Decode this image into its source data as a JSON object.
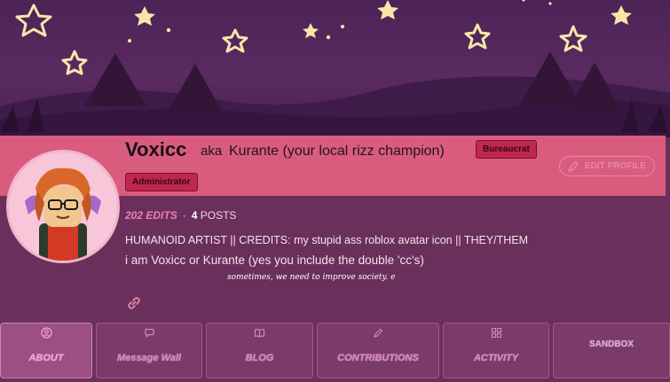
{
  "profile": {
    "username": "Voxicc",
    "aka_prefix": "aka",
    "aka_name": "Kurante (your local rizz champion)",
    "badges": [
      "Bureaucrat",
      "Administrator"
    ],
    "edit_profile_label": "EDIT PROFILE",
    "edits": "202 EDITS",
    "separator": "·",
    "posts_count": "4",
    "posts_label": "POSTS",
    "bio_line1": "HUMANOID ARTIST || CREDITS: my stupid ass roblox avatar icon || THEY/THEM",
    "bio_line2": "i am Voxicc or Kurante (yes you include the double 'cc's)",
    "bio_line3": "sometimes, we need to improve society. e"
  },
  "tabs": [
    {
      "label": "ABOUT",
      "icon": "user-icon"
    },
    {
      "label": "Message Wall",
      "icon": "speech-bubble-icon"
    },
    {
      "label": "BLOG",
      "icon": "book-icon"
    },
    {
      "label": "CONTRIBUTIONS",
      "icon": "pencil-icon"
    },
    {
      "label": "ACTIVITY",
      "icon": "grid-icon"
    },
    {
      "label": "SANDBOX",
      "icon": ""
    }
  ],
  "colors": {
    "banner": "#4d2356",
    "pink_band": "#d95c7f",
    "body": "#6b2f5b",
    "badge": "#c0264f",
    "accent": "#f07fad"
  }
}
